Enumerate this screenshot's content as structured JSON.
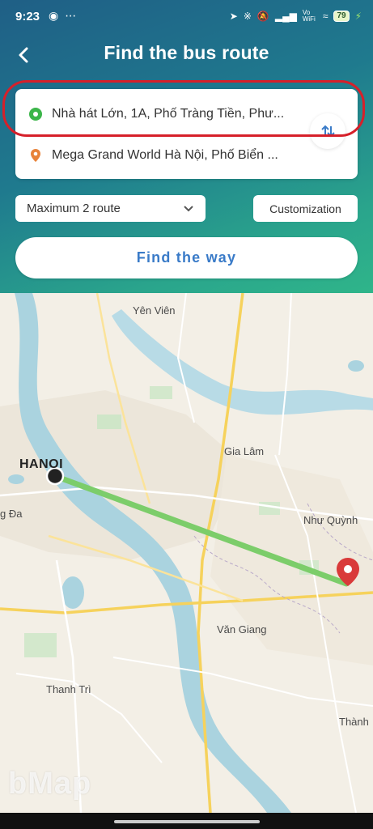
{
  "status_bar": {
    "time": "9:23",
    "battery": "79",
    "network": "Vo WiFi"
  },
  "header": {
    "title": "Find the bus route"
  },
  "route": {
    "origin": "Nhà hát Lớn, 1A, Phố Tràng Tiền, Phư...",
    "destination": "Mega Grand World Hà Nội, Phố Biển ..."
  },
  "options": {
    "max_route": "Maximum 2 route",
    "customization": "Customization"
  },
  "find_button": "Find the way",
  "map": {
    "labels": {
      "yen_vien": "Yên Viên",
      "hanoi": "HANOI",
      "gia_lam": "Gia Lâm",
      "dong_da": "g Đa",
      "nhu_quynh": "Như Quỳnh",
      "van_giang": "Văn Giang",
      "thanh_tri": "Thanh Trì",
      "thanh": "Thành"
    },
    "watermark": "bMap"
  },
  "colors": {
    "route_line": "#7ccd6a",
    "destination_pin": "#d93a3a",
    "origin_dot": "#3cb54a",
    "accent": "#3a7bc8"
  }
}
